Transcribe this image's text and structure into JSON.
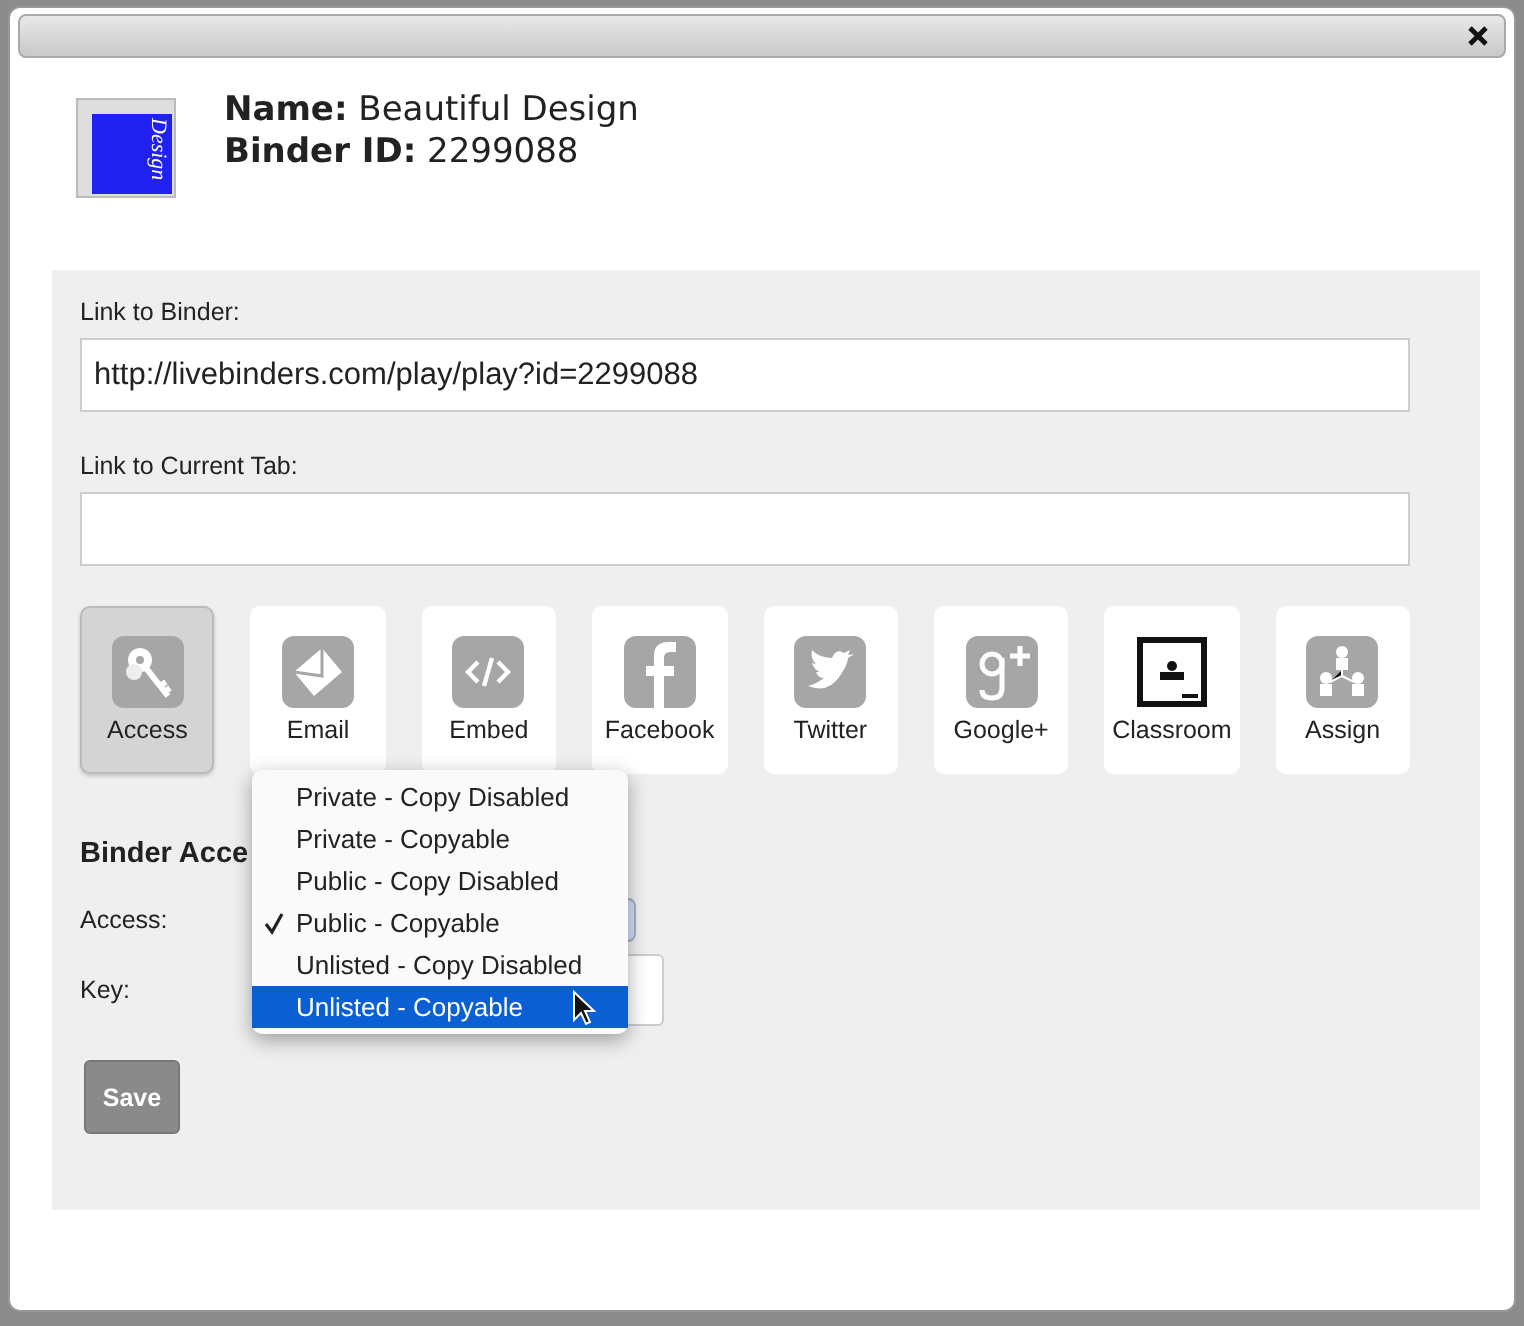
{
  "binder": {
    "cover_text": "Design",
    "name_label": "Name:",
    "name": "Beautiful Design",
    "id_label": "Binder ID:",
    "id": "2299088"
  },
  "link_to_binder": {
    "label": "Link to Binder:",
    "value": "http://livebinders.com/play/play?id=2299088"
  },
  "link_to_current_tab": {
    "label": "Link to Current Tab:"
  },
  "share_options": [
    {
      "label": "Access",
      "kind": "access",
      "selected": true
    },
    {
      "label": "Email",
      "kind": "email",
      "selected": false
    },
    {
      "label": "Embed",
      "kind": "embed",
      "selected": false
    },
    {
      "label": "Facebook",
      "kind": "facebook",
      "selected": false
    },
    {
      "label": "Twitter",
      "kind": "twitter",
      "selected": false
    },
    {
      "label": "Google+",
      "kind": "googleplus",
      "selected": false
    },
    {
      "label": "Classroom",
      "kind": "classroom",
      "selected": false
    },
    {
      "label": "Assign",
      "kind": "assign",
      "selected": false
    }
  ],
  "access_section": {
    "heading": "Binder Acce",
    "access_label": "Access:",
    "key_label": "Key:"
  },
  "access_menu": [
    {
      "label": "Private - Copy Disabled",
      "checked": false,
      "selected": false
    },
    {
      "label": "Private - Copyable",
      "checked": false,
      "selected": false
    },
    {
      "label": "Public - Copy Disabled",
      "checked": false,
      "selected": false
    },
    {
      "label": "Public - Copyable",
      "checked": true,
      "selected": false
    },
    {
      "label": "Unlisted - Copy Disabled",
      "checked": false,
      "selected": false
    },
    {
      "label": "Unlisted - Copyable",
      "checked": false,
      "selected": true
    }
  ],
  "save_button": "Save"
}
